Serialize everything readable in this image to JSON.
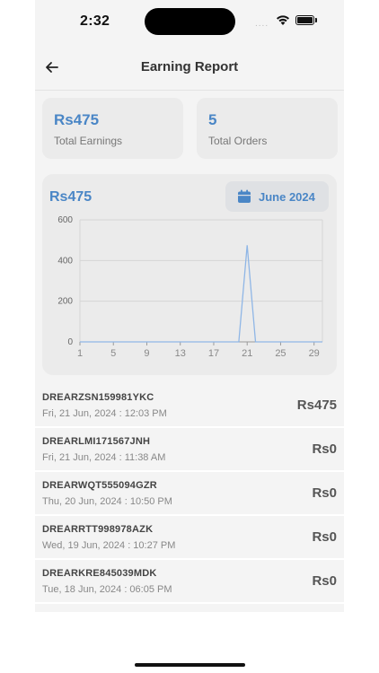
{
  "status_bar": {
    "time": "2:32",
    "signal": "....",
    "icons": [
      "wifi-icon",
      "battery-icon"
    ]
  },
  "header": {
    "title": "Earning Report",
    "back_icon": "arrow-left-icon"
  },
  "stats": [
    {
      "value": "Rs475",
      "label": "Total Earnings"
    },
    {
      "value": "5",
      "label": "Total Orders"
    }
  ],
  "chart_card": {
    "total": "Rs475",
    "month_label": "June 2024",
    "month_icon": "calendar-icon"
  },
  "chart_data": {
    "type": "line",
    "x": [
      1,
      2,
      3,
      4,
      5,
      6,
      7,
      8,
      9,
      10,
      11,
      12,
      13,
      14,
      15,
      16,
      17,
      18,
      19,
      20,
      21,
      22,
      23,
      24,
      25,
      26,
      27,
      28,
      29,
      30
    ],
    "series": [
      {
        "values": [
          0,
          0,
          0,
          0,
          0,
          0,
          0,
          0,
          0,
          0,
          0,
          0,
          0,
          0,
          0,
          0,
          0,
          0,
          0,
          0,
          475,
          0,
          0,
          0,
          0,
          0,
          0,
          0,
          0,
          0
        ]
      }
    ],
    "x_ticks": [
      1,
      5,
      9,
      13,
      17,
      21,
      25,
      29
    ],
    "y_ticks": [
      0,
      200,
      400,
      600
    ],
    "xlim": [
      1,
      30
    ],
    "ylim": [
      0,
      600
    ],
    "grid": true,
    "color": "#8fb6e6"
  },
  "orders": [
    {
      "id": "DREARZSN159981YKC",
      "date": "Fri, 21 Jun, 2024 : 12:03 PM",
      "amount": "Rs475"
    },
    {
      "id": "DREARLMI171567JNH",
      "date": "Fri, 21 Jun, 2024 : 11:38 AM",
      "amount": "Rs0"
    },
    {
      "id": "DREARWQT555094GZR",
      "date": "Thu, 20 Jun, 2024 : 10:50 PM",
      "amount": "Rs0"
    },
    {
      "id": "DREARRTT998978AZK",
      "date": "Wed, 19 Jun, 2024 : 10:27 PM",
      "amount": "Rs0"
    },
    {
      "id": "DREARKRE845039MDK",
      "date": "Tue, 18 Jun, 2024 : 06:05 PM",
      "amount": "Rs0"
    }
  ],
  "colors": {
    "accent": "#4a86c6",
    "background": "#f4f4f4",
    "card": "#ebebeb"
  }
}
